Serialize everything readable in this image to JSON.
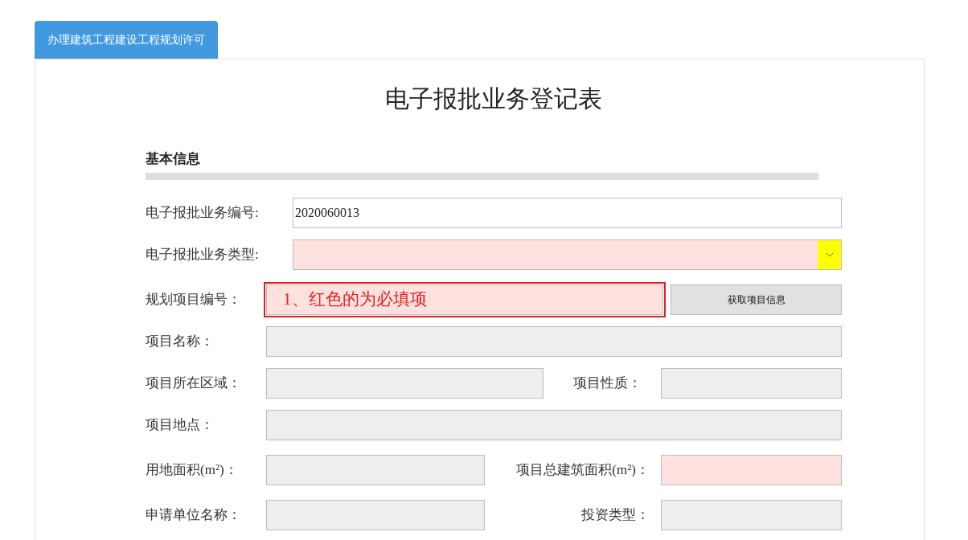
{
  "tabs": [
    {
      "label": "办理建筑工程建设工程规划许可",
      "selected": true
    }
  ],
  "form": {
    "title": "电子报批业务登记表",
    "section": "基本信息",
    "rows": [
      {
        "kind": "wide",
        "fields": [
          {
            "label": "电子报批业务编号:",
            "value": "2020060013",
            "required": false,
            "readonly": false
          }
        ]
      },
      {
        "kind": "wide",
        "fields": [
          {
            "label": "电子报批业务类型:",
            "required": true,
            "dropdown": true
          }
        ]
      },
      {
        "kind": "button",
        "fields": [
          {
            "label": "规划项目编号：",
            "required": true,
            "note": "1、红色的为必填项"
          }
        ],
        "button": "获取项目信息"
      },
      {
        "kind": "full",
        "fields": [
          {
            "label": "项目名称：",
            "required": false,
            "readonly": true
          }
        ]
      },
      {
        "kind": "pair",
        "fields": [
          {
            "label": "项目所在区域：",
            "required": false,
            "readonly": true
          },
          {
            "label": "项目性质：",
            "required": false,
            "readonly": true
          }
        ]
      },
      {
        "kind": "full",
        "fields": [
          {
            "label": "项目地点：",
            "required": false,
            "readonly": true
          }
        ]
      },
      {
        "kind": "narrowpair",
        "fields": [
          {
            "label": "用地面积(m²)：",
            "required": false,
            "readonly": true
          },
          {
            "label": "项目总建筑面积(m²)：",
            "required": true
          }
        ]
      },
      {
        "kind": "narrowpair",
        "fields": [
          {
            "label": "申请单位名称：",
            "required": false,
            "readonly": true
          },
          {
            "label": "投资类型：",
            "required": false,
            "readonly": true
          }
        ]
      }
    ]
  }
}
